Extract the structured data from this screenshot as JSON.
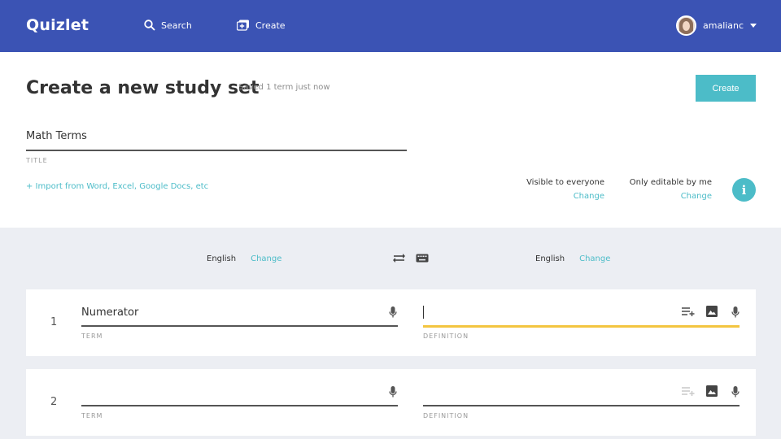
{
  "topbar": {
    "logo": "Quizlet",
    "search_label": "Search",
    "create_label": "Create",
    "username": "amalianc",
    "bg_color": "#3b53b4"
  },
  "header": {
    "title": "Create a new study set",
    "saved_status": "Saved 1 term just now",
    "create_button": "Create",
    "set_title_value": "Math Terms",
    "set_title_label": "TITLE",
    "import_link": "+ Import from Word, Excel, Google Docs, etc",
    "visibility": {
      "label": "Visible to everyone",
      "change": "Change"
    },
    "editability": {
      "label": "Only editable by me",
      "change": "Change"
    },
    "info_icon": "i"
  },
  "languages": {
    "term_language": "English",
    "term_change": "Change",
    "definition_language": "English",
    "definition_change": "Change"
  },
  "cards": [
    {
      "number": "1",
      "term": "Numerator",
      "definition": "",
      "term_label": "TERM",
      "definition_label": "DEFINITION"
    },
    {
      "number": "2",
      "term": "",
      "definition": "",
      "term_label": "TERM",
      "definition_label": "DEFINITION"
    }
  ],
  "colors": {
    "accent": "#4cbcc8",
    "active_underline": "#f3c540"
  }
}
